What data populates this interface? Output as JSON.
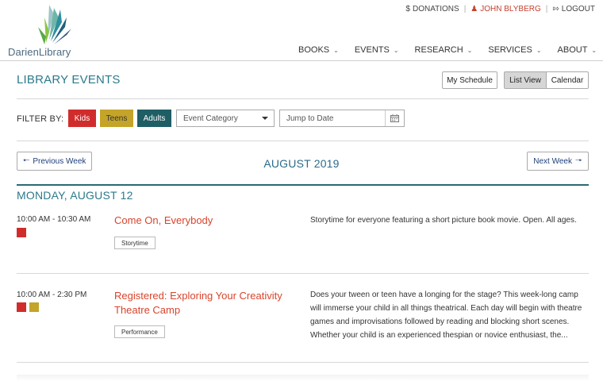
{
  "brand": {
    "logo_text": "DarienLibrary"
  },
  "utility": {
    "donations": "DONATIONS",
    "user": "JOHN BLYBERG",
    "logout": "LOGOUT"
  },
  "nav": {
    "items": [
      {
        "label": "BOOKS"
      },
      {
        "label": "EVENTS"
      },
      {
        "label": "RESEARCH"
      },
      {
        "label": "SERVICES"
      },
      {
        "label": "ABOUT"
      }
    ]
  },
  "page": {
    "title": "LIBRARY EVENTS",
    "my_schedule": "My Schedule",
    "list_view": "List View",
    "calendar": "Calendar"
  },
  "filters": {
    "label": "FILTER BY:",
    "kids": "Kids",
    "teens": "Teens",
    "adults": "Adults",
    "category_placeholder": "Event Category",
    "date_placeholder": "Jump to Date"
  },
  "week": {
    "prev": "Previous Week",
    "next": "Next Week",
    "month": "AUGUST 2019"
  },
  "day": {
    "heading": "MONDAY, AUGUST 12",
    "events": [
      {
        "time": "10:00 AM - 10:30 AM",
        "title": "Come On, Everybody",
        "category": "Storytime",
        "audiences": [
          "Kids"
        ],
        "description": "Storytime for everyone featuring a short picture book movie. Open. All ages."
      },
      {
        "time": "10:00 AM - 2:30 PM",
        "title_line1": "Registered: Exploring Your Creativity",
        "title_line2": "Theatre Camp",
        "category": "Performance",
        "audiences": [
          "Kids",
          "Teens"
        ],
        "description": "Does your tween or teen have a longing for the stage? This week-long camp will immerse your child in all things theatrical. Each day will begin with theatre games and improvisations followed by reading and blocking short scenes. Whether your child is an experienced thespian or novice enthusiast, the..."
      }
    ]
  },
  "colors": {
    "kids": "#d12c2c",
    "teens": "#c4a429",
    "adults": "#1f5e65",
    "accent_teal": "#2b7a8a",
    "event_title": "#d9442c"
  }
}
